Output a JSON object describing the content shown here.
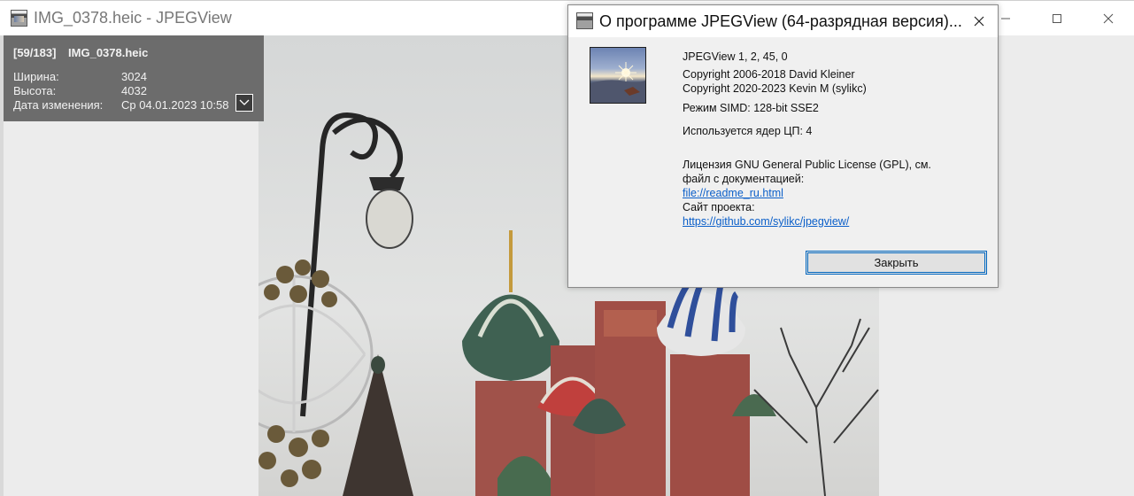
{
  "window": {
    "title": "IMG_0378.heic - JPEGView",
    "icon": "jpegview-app-icon",
    "controls": [
      "minimize",
      "maximize",
      "close"
    ]
  },
  "info_panel": {
    "index": "[59/183]",
    "filename": "IMG_0378.heic",
    "rows": [
      {
        "label": "Ширина:",
        "value": "3024"
      },
      {
        "label": "Высота:",
        "value": "4032"
      },
      {
        "label": "Дата изменения:",
        "value": "Ср 04.01.2023 10:58"
      }
    ]
  },
  "about_dialog": {
    "title": "О программе JPEGView (64-разрядная версия)...",
    "version": "JPEGView 1, 2, 45, 0",
    "copyright1": "Copyright 2006-2018 David Kleiner",
    "copyright2": "Copyright 2020-2023 Kevin M (sylikc)",
    "simd": "Режим SIMD: 128-bit SSE2",
    "cores": "Используется ядер ЦП: 4",
    "license_line1": "Лицензия GNU General Public License (GPL),    см.",
    "license_line2": " файл с документацией:",
    "readme_link": "file://readme_ru.html",
    "site_label": "Сайт проекта:",
    "site_link": "https://github.com/sylikc/jpegview/",
    "close_button": "Закрыть"
  },
  "colors": {
    "overlay_bg": "#6c6c6c",
    "link": "#0b5fc9",
    "button_focus": "#0067c0",
    "dialog_bg": "#f0f0f0"
  }
}
